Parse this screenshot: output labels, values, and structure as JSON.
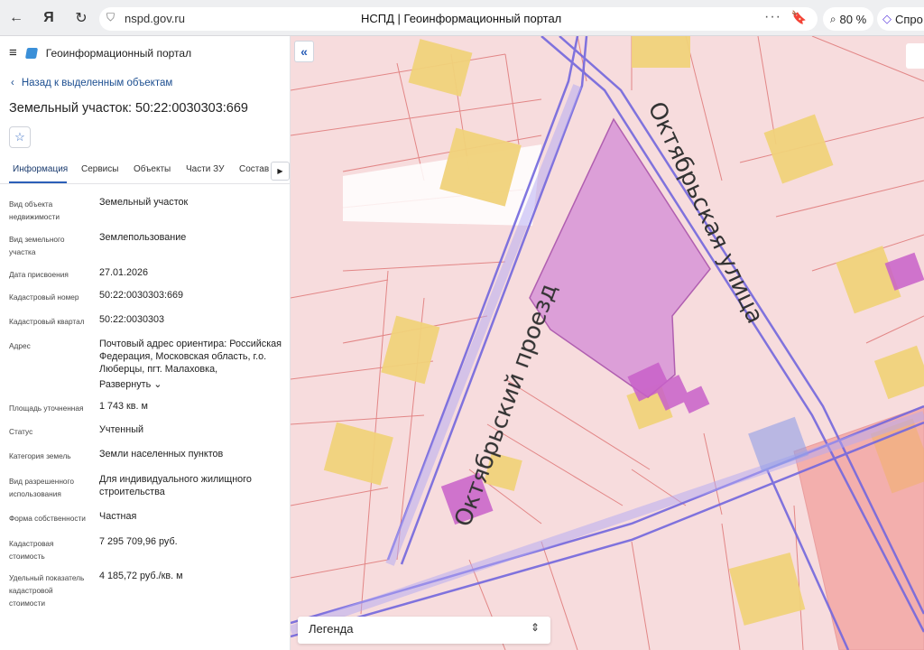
{
  "browser": {
    "url": "nspd.gov.ru",
    "title": "НСПД | Геоинформационный портал",
    "zoom": "80 %",
    "ask_label": "Спро"
  },
  "app": {
    "name": "Геоинформационный портал"
  },
  "nav": {
    "back_label": "Назад к выделенным объектам"
  },
  "object": {
    "title": "Земельный участок: 50:22:0030303:669"
  },
  "tabs": [
    {
      "label": "Информация",
      "active": true
    },
    {
      "label": "Сервисы",
      "active": false
    },
    {
      "label": "Объекты",
      "active": false
    },
    {
      "label": "Части ЗУ",
      "active": false
    },
    {
      "label": "Состав",
      "active": false
    }
  ],
  "attributes": [
    {
      "label": "Вид объекта недвижимости",
      "value": "Земельный участок"
    },
    {
      "label": "Вид земельного участка",
      "value": "Землепользование"
    },
    {
      "label": "Дата присвоения",
      "value": "27.01.2026"
    },
    {
      "label": "Кадастровый номер",
      "value": "50:22:0030303:669"
    },
    {
      "label": "Кадастровый квартал",
      "value": "50:22:0030303"
    },
    {
      "label": "Адрес",
      "value": "Почтовый адрес ориентира: Российская Федерация, Московская область, г.о. Люберцы, пгт. Малаховка,",
      "expand": "Развернуть"
    },
    {
      "label": "Площадь уточненная",
      "value": "1 743 кв. м"
    },
    {
      "label": "Статус",
      "value": "Учтенный"
    },
    {
      "label": "Категория земель",
      "value": "Земли населенных пунктов"
    },
    {
      "label": "Вид разрешенного использования",
      "value": "Для индивидуального жилищного строительства"
    },
    {
      "label": "Форма собственности",
      "value": "Частная"
    },
    {
      "label": "Кадастровая стоимость",
      "value": "7 295 709,96 руб."
    },
    {
      "label": "Удельный показатель кадастровой стоимости",
      "value": "4 185,72 руб./кв. м"
    }
  ],
  "map": {
    "street_labels": [
      "Октябрьский проезд",
      "Октябрьская улица"
    ],
    "legend_label": "Легенда",
    "colors": {
      "parcel_fill": "#f6d6d8",
      "parcel_line": "#e07a7a",
      "building": "#f0d37a",
      "selected": "#d79ad9",
      "road": "#7a6fe0"
    }
  }
}
